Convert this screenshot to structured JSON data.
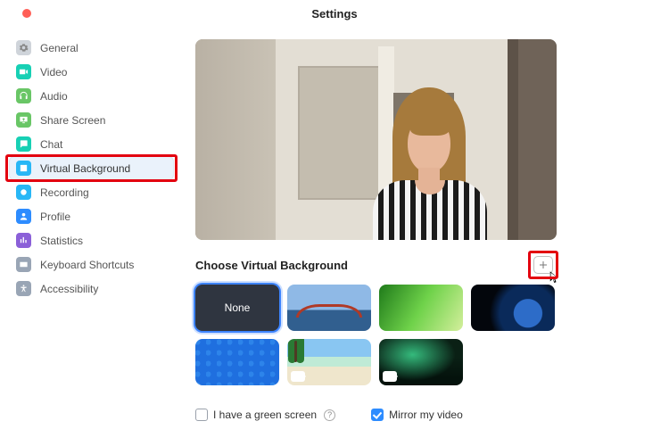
{
  "window": {
    "title": "Settings"
  },
  "sidebar": {
    "items": [
      {
        "label": "General",
        "icon": "gear-icon"
      },
      {
        "label": "Video",
        "icon": "video-icon"
      },
      {
        "label": "Audio",
        "icon": "headphones-icon"
      },
      {
        "label": "Share Screen",
        "icon": "share-screen-icon"
      },
      {
        "label": "Chat",
        "icon": "chat-icon"
      },
      {
        "label": "Virtual Background",
        "icon": "person-box-icon",
        "selected": true,
        "highlighted": true
      },
      {
        "label": "Recording",
        "icon": "record-icon"
      },
      {
        "label": "Profile",
        "icon": "profile-icon"
      },
      {
        "label": "Statistics",
        "icon": "stats-icon"
      },
      {
        "label": "Keyboard Shortcuts",
        "icon": "keyboard-icon"
      },
      {
        "label": "Accessibility",
        "icon": "accessibility-icon"
      }
    ]
  },
  "main": {
    "section_title": "Choose Virtual Background",
    "add_button": {
      "title": "Add Image or Video",
      "highlighted": true
    },
    "thumbnails": [
      {
        "name": "none",
        "label": "None",
        "selected": true
      },
      {
        "name": "golden-gate"
      },
      {
        "name": "grass"
      },
      {
        "name": "earth-space"
      },
      {
        "name": "blue-pattern"
      },
      {
        "name": "beach",
        "is_video": true
      },
      {
        "name": "aurora",
        "is_video": true
      }
    ],
    "options": {
      "green_screen": {
        "label": "I have a green screen",
        "checked": false,
        "help": true
      },
      "mirror": {
        "label": "Mirror my video",
        "checked": true
      }
    }
  }
}
